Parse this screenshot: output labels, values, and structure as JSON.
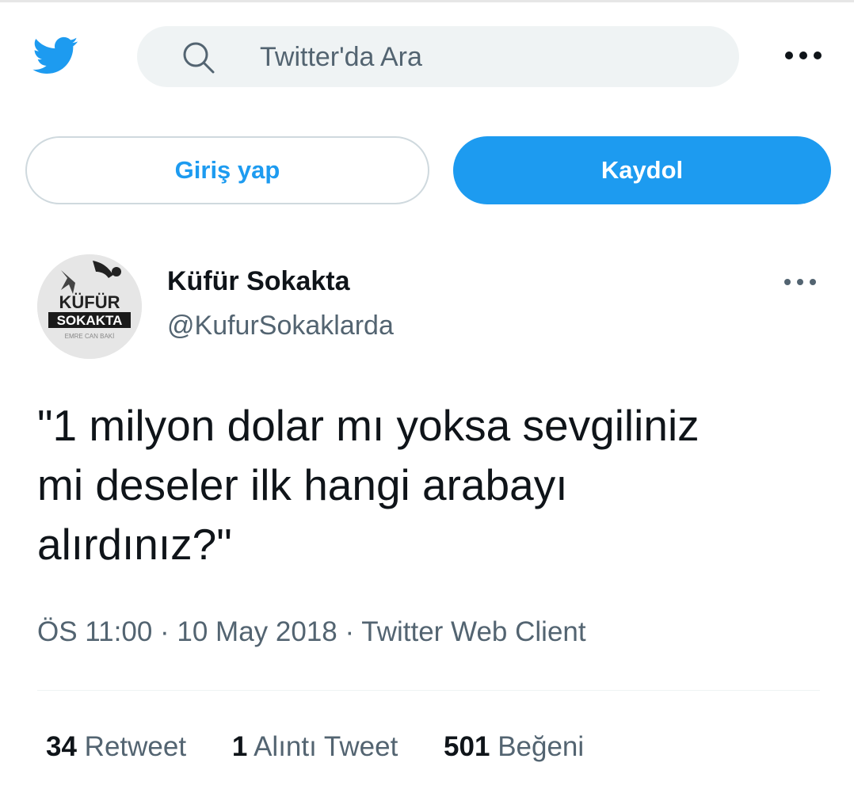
{
  "header": {
    "search_placeholder": "Twitter'da Ara",
    "icons": {
      "logo": "twitter-bird-icon",
      "search": "search-icon",
      "more": "more-horizontal-icon"
    }
  },
  "auth": {
    "login_label": "Giriş yap",
    "signup_label": "Kaydol"
  },
  "tweet": {
    "author_name": "Küfür Sokakta",
    "author_handle": "@KufurSokaklarda",
    "avatar_text": {
      "line1": "KÜFÜR",
      "line2": "SOKAKTA",
      "line3": "EMRE CAN BAKİ"
    },
    "text": "\"1 milyon dolar mı yoksa sevgiliniz\nmi deseler ilk hangi arabayı\nalırdınız?\"",
    "time": "ÖS 11:00",
    "date": "10 May 2018",
    "source": "Twitter Web Client",
    "separator": "·",
    "stats": {
      "retweets": {
        "count": "34",
        "label": "Retweet"
      },
      "quotes": {
        "count": "1",
        "label": "Alıntı Tweet"
      },
      "likes": {
        "count": "501",
        "label": "Beğeni"
      }
    }
  },
  "colors": {
    "accent": "#1d9bf0",
    "text": "#0f1419",
    "muted": "#536471",
    "search_bg": "#eff3f4"
  }
}
